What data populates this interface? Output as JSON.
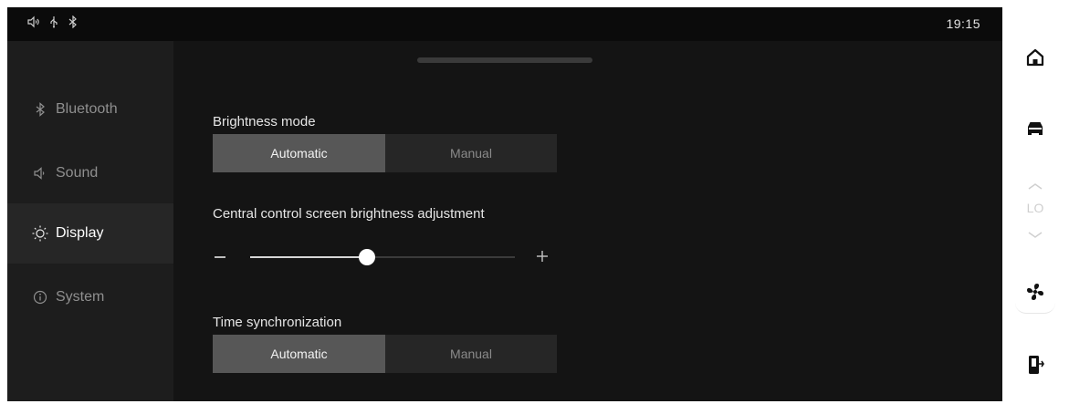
{
  "status_bar": {
    "icons": [
      "speaker-icon",
      "usb-icon",
      "bluetooth-icon"
    ],
    "time": "19:15"
  },
  "sidebar": {
    "items": [
      {
        "label": "Bluetooth",
        "icon": "bluetooth-icon",
        "active": false
      },
      {
        "label": "Sound",
        "icon": "speaker-icon",
        "active": false
      },
      {
        "label": "Display",
        "icon": "brightness-icon",
        "active": true
      },
      {
        "label": "System",
        "icon": "info-icon",
        "active": false
      }
    ]
  },
  "main": {
    "brightness_mode": {
      "title": "Brightness mode",
      "options": [
        "Automatic",
        "Manual"
      ],
      "selected": "Automatic"
    },
    "brightness_adjustment": {
      "title": "Central control screen brightness adjustment",
      "value_fraction": 0.44
    },
    "time_sync": {
      "title": "Time synchronization",
      "options": [
        "Automatic",
        "Manual"
      ],
      "selected": "Automatic"
    }
  },
  "rail": {
    "icons": [
      "home-icon",
      "car-icon",
      "temp-up-icon",
      "temp-down-icon",
      "fan-icon",
      "door-exit-icon"
    ],
    "temperature": "LO"
  },
  "colors": {
    "background": "#141414",
    "sidebar": "#1d1d1d",
    "selected_segment": "#575757",
    "segment": "#262626",
    "rail": "#ffffff"
  }
}
